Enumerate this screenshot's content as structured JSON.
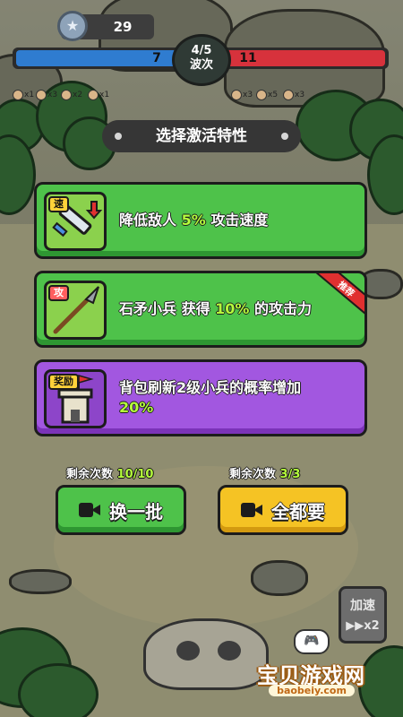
{
  "hud": {
    "coins": "29",
    "coin_icon": "star-icon",
    "wave_left": "7",
    "wave_right": "11",
    "wave_count": "4/5",
    "wave_label": "波次",
    "units_left": [
      "x1",
      "x3",
      "x2",
      "x1"
    ],
    "units_right": [
      "x3",
      "x5",
      "x3"
    ]
  },
  "title": "选择激活特性",
  "options": [
    {
      "tag": "速",
      "icon": "sword-speed-down-icon",
      "text_before": "降低敌人 ",
      "highlight": "5%",
      "text_after": " 攻击速度",
      "recommended": false
    },
    {
      "tag": "攻",
      "icon": "spear-icon",
      "text_before": "石矛小兵 获得 ",
      "highlight": "10%",
      "text_after": " 的攻击力",
      "recommended": true,
      "ribbon": "推荐"
    },
    {
      "tag": "奖励",
      "icon": "castle-flag-icon",
      "text_before": "背包刷新2级小兵的概率增加",
      "highlight": "20%",
      "text_after": "",
      "recommended": false
    }
  ],
  "actions": {
    "refresh": {
      "count_label": "剩余次数",
      "count_value": "10/10",
      "label": "换一批"
    },
    "take_all": {
      "count_label": "剩余次数",
      "count_value": "3/3",
      "label": "全都要"
    }
  },
  "speed": {
    "label": "加速",
    "multiplier": "▶▶x2"
  },
  "watermark": {
    "title": "宝贝游戏网",
    "url": "baobeiy.com"
  },
  "colors": {
    "green": "#4ec24a",
    "purple": "#a257e0",
    "yellow": "#f5c324",
    "highlight": "#b6ff3c",
    "blue": "#2f7cd0",
    "red": "#d7323c"
  }
}
